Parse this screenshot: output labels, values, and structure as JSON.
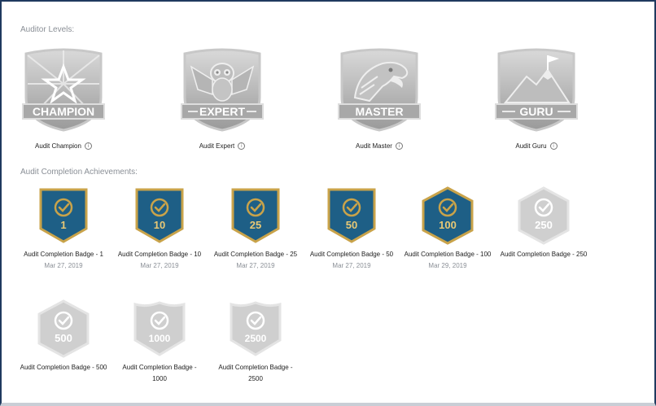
{
  "sections": {
    "levels_title": "Auditor Levels:",
    "achievements_title": "Audit Completion Achievements:"
  },
  "levels": [
    {
      "banner": "CHAMPION",
      "label": "Audit Champion",
      "icon": "star-icon"
    },
    {
      "banner": "EXPERT",
      "label": "Audit Expert",
      "icon": "owl-icon"
    },
    {
      "banner": "MASTER",
      "label": "Audit Master",
      "icon": "eagle-icon"
    },
    {
      "banner": "GURU",
      "label": "Audit Guru",
      "icon": "mountain-flag-icon"
    }
  ],
  "badges": [
    {
      "number": "1",
      "label": "Audit Completion Badge - 1",
      "date": "Mar 27, 2019",
      "earned": true
    },
    {
      "number": "10",
      "label": "Audit Completion Badge - 10",
      "date": "Mar 27, 2019",
      "earned": true
    },
    {
      "number": "25",
      "label": "Audit Completion Badge - 25",
      "date": "Mar 27, 2019",
      "earned": true
    },
    {
      "number": "50",
      "label": "Audit Completion Badge - 50",
      "date": "Mar 27, 2019",
      "earned": true
    },
    {
      "number": "100",
      "label": "Audit Completion Badge - 100",
      "date": "Mar 29, 2019",
      "earned": true
    },
    {
      "number": "250",
      "label": "Audit Completion Badge - 250",
      "date": "",
      "earned": false
    },
    {
      "number": "500",
      "label": "Audit Completion Badge - 500",
      "date": "",
      "earned": false
    },
    {
      "number": "1000",
      "label": "Audit Completion Badge - 1000",
      "date": "",
      "earned": false
    },
    {
      "number": "2500",
      "label": "Audit Completion Badge - 2500",
      "date": "",
      "earned": false
    }
  ],
  "colors": {
    "earned_fill": "#1e5f86",
    "earned_border": "#c9a34a",
    "locked_fill": "#cfcfcf",
    "locked_border": "#e4e4e4"
  }
}
